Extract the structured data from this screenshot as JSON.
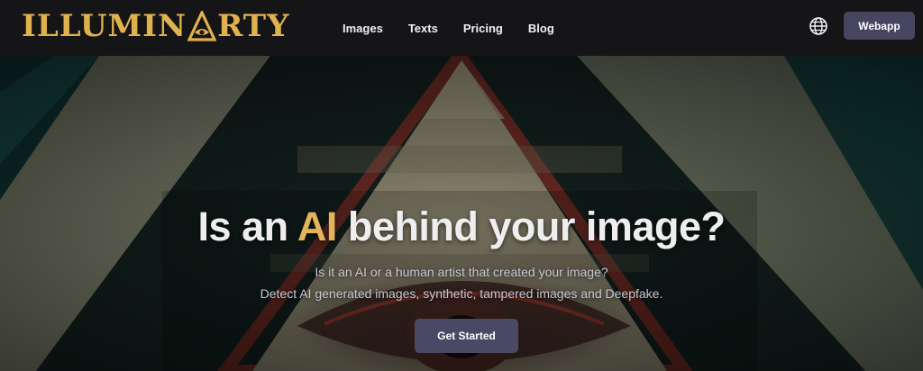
{
  "header": {
    "logo_part1": "ILLUMIN",
    "logo_part2": "RTY",
    "nav": [
      {
        "label": "Images"
      },
      {
        "label": "Texts"
      },
      {
        "label": "Pricing"
      },
      {
        "label": "Blog"
      }
    ],
    "language_icon": "globe-icon",
    "webapp_label": "Webapp"
  },
  "hero": {
    "title_before": "Is an ",
    "title_accent": "AI",
    "title_after": " behind your image?",
    "subtitle_line1": "Is it an AI or a human artist that created your image?",
    "subtitle_line2": "Detect AI generated images, synthetic, tampered images and Deepfake.",
    "cta_label": "Get Started"
  },
  "colors": {
    "accent_gold": "#e0b24f",
    "button_bg": "#474562",
    "nav_bg": "#151416"
  }
}
